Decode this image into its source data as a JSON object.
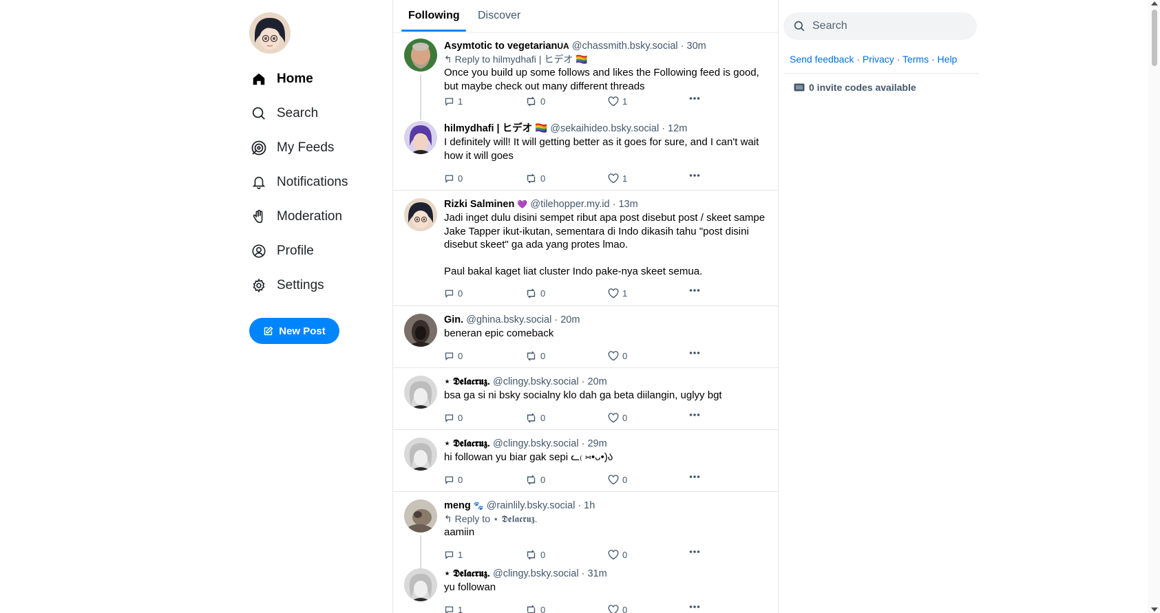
{
  "nav": {
    "items": [
      {
        "label": "Home",
        "icon": "home-icon",
        "active": true
      },
      {
        "label": "Search",
        "icon": "search-icon"
      },
      {
        "label": "My Feeds",
        "icon": "feeds-icon"
      },
      {
        "label": "Notifications",
        "icon": "bell-icon"
      },
      {
        "label": "Moderation",
        "icon": "hand-icon"
      },
      {
        "label": "Profile",
        "icon": "profile-icon"
      },
      {
        "label": "Settings",
        "icon": "gear-icon"
      }
    ],
    "new_post_label": "New Post"
  },
  "tabs": {
    "following": "Following",
    "discover": "Discover"
  },
  "posts": [
    {
      "author": "Asymtotic to vegetarian",
      "badge": "UA",
      "handle": "@chassmith.bsky.social",
      "time": "· 30m",
      "reply_to": "Reply to  hilmydhafi | ヒデオ 🏳️‍🌈",
      "text": "Once you build up some follows and likes the Following feed is good, but maybe check out many different threads",
      "replies": "1",
      "reposts": "0",
      "likes": "1"
    },
    {
      "author": "hilmydhafi | ヒデオ 🏳️‍🌈",
      "handle": "@sekaihideo.bsky.social",
      "time": "· 12m",
      "text": "I definitely will! It will getting better as it goes for sure, and I can't wait how it will goes",
      "replies": "0",
      "reposts": "0",
      "likes": "1"
    },
    {
      "author": "Rizki Salminen",
      "badge": "💜",
      "handle": "@tilehopper.my.id",
      "time": "· 13m",
      "text": "Jadi inget dulu disini sempet ribut apa post disebut post / skeet sampe Jake Tapper ikut-ikutan, sementara di Indo dikasih tahu \"post disini disebut skeet\" ga ada yang protes lmao.\n\nPaul bakal kaget liat cluster Indo pake-nya skeet semua.",
      "replies": "0",
      "reposts": "0",
      "likes": "1"
    },
    {
      "author": "Gin.",
      "handle": "@ghina.bsky.social",
      "time": "· 20m",
      "text": "beneran epic comeback",
      "replies": "0",
      "reposts": "0",
      "likes": "0"
    },
    {
      "author": "⋆ 𝕯𝖊𝖑𝖆𝖈𝖗𝖚𝖟.",
      "handle": "@clingy.bsky.social",
      "time": "· 20m",
      "text": "bsa ga si ni bsky socialny klo dah ga beta diilangin, uglyy bgt",
      "replies": "0",
      "reposts": "0",
      "likes": "0"
    },
    {
      "author": "⋆ 𝕯𝖊𝖑𝖆𝖈𝖗𝖚𝖟.",
      "handle": "@clingy.bsky.social",
      "time": "· 29m",
      "text": "hi followan yu biar gak sepi ᓚ₍ ⑅•ᴗ•)ა",
      "replies": "0",
      "reposts": "0",
      "likes": "0"
    },
    {
      "author": "meng",
      "badge": "🐾",
      "handle": "@rainlily.bsky.social",
      "time": "· 1h",
      "reply_to": "Reply to  ⋆ 𝕯𝖊𝖑𝖆𝖈𝖗𝖚𝖟.",
      "text": "aamiin",
      "replies": "1",
      "reposts": "0",
      "likes": "0"
    },
    {
      "author": "⋆ 𝕯𝖊𝖑𝖆𝖈𝖗𝖚𝖟.",
      "handle": "@clingy.bsky.social",
      "time": "· 31m",
      "text": "yu followan",
      "replies": "1",
      "reposts": "0",
      "likes": "0"
    }
  ],
  "right": {
    "search_placeholder": "Search",
    "links": [
      "Send feedback",
      "Privacy",
      "Terms",
      "Help"
    ],
    "link_sep": " · ",
    "invites": "0 invite codes available"
  },
  "colors": {
    "accent": "#0085ff",
    "link": "#0070e0",
    "muted": "#42576c"
  }
}
